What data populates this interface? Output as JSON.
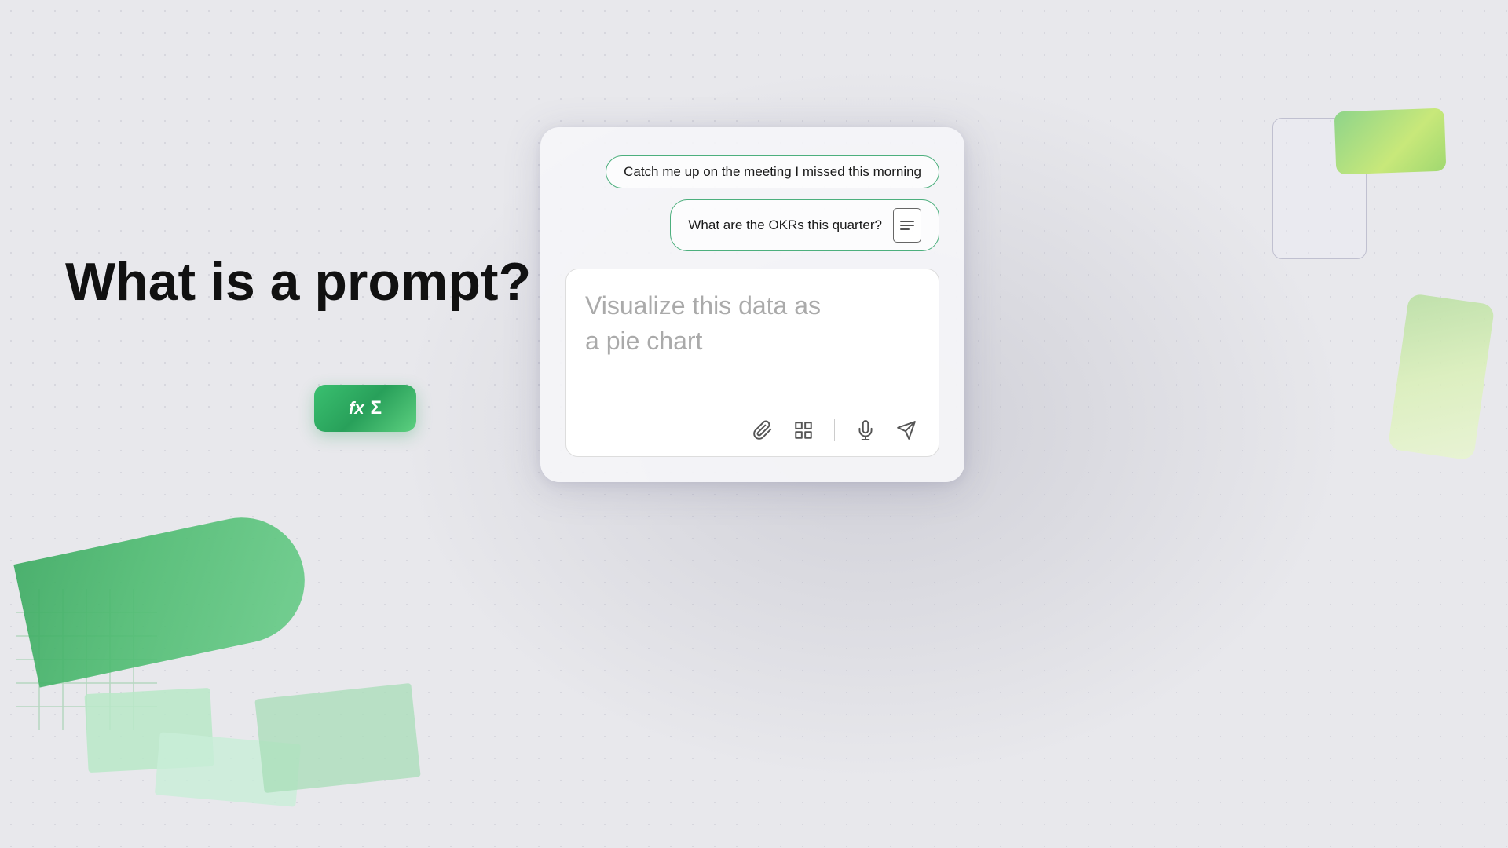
{
  "page": {
    "background_color": "#e9e9ed"
  },
  "main_title": {
    "line1": "What is a prompt?"
  },
  "chat_panel": {
    "bubble1": {
      "text": "Catch me up on the meeting I missed this morning"
    },
    "bubble2": {
      "text": "What are the OKRs this quarter?"
    },
    "input": {
      "placeholder": "Visualize this data as\na pie chart"
    },
    "toolbar": {
      "attach_label": "Attach",
      "grid_label": "Grid",
      "mic_label": "Microphone",
      "send_label": "Send"
    }
  },
  "fx_card": {
    "fx": "fx",
    "sigma": "Σ"
  }
}
